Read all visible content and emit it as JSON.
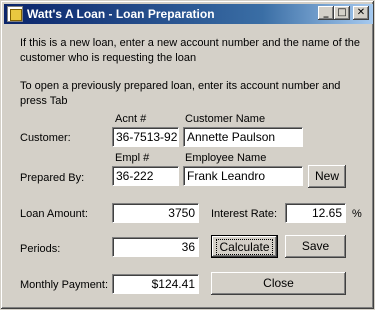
{
  "window": {
    "title": "Watt's A Loan - Loan Preparation",
    "minimize_glyph": "_",
    "maximize_glyph": "□",
    "close_glyph": "✕"
  },
  "instructions": {
    "line1": "If this is a new loan, enter a new account number and the name of the",
    "line2": "customer who is requesting the loan",
    "line3": "To open a previously prepared loan, enter its account number and",
    "line4": "press Tab"
  },
  "customer": {
    "label": "Customer:",
    "acnt_header": "Acnt #",
    "name_header": "Customer Name",
    "acnt_value": "36-7513-92",
    "name_value": "Annette Paulson"
  },
  "prepared_by": {
    "label": "Prepared By:",
    "empl_header": "Empl #",
    "name_header": "Employee Name",
    "empl_value": "36-222",
    "name_value": "Frank Leandro",
    "new_button": "New"
  },
  "loan": {
    "amount_label": "Loan Amount:",
    "amount_value": "3750",
    "rate_label": "Interest Rate:",
    "rate_value": "12.65",
    "rate_unit": "%",
    "periods_label": "Periods:",
    "periods_value": "36",
    "payment_label": "Monthly Payment:",
    "payment_value": "$124.41"
  },
  "buttons": {
    "calculate": "Calculate",
    "save": "Save",
    "close": "Close"
  }
}
